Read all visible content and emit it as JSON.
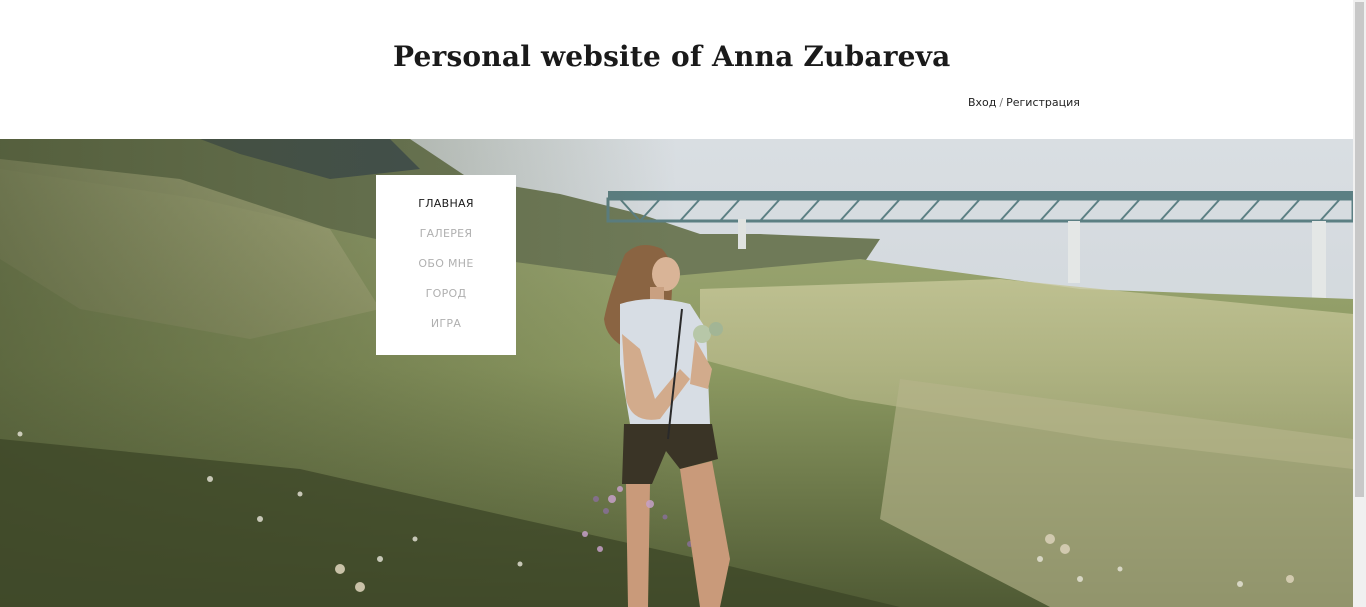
{
  "header": {
    "title": "Personal website of Anna Zubareva",
    "auth": {
      "login_label": "Вход",
      "separator": "/",
      "register_label": "Регистрация"
    }
  },
  "nav": {
    "items": [
      {
        "label": "ГЛАВНАЯ",
        "active": true
      },
      {
        "label": "ГАЛЕРЕЯ",
        "active": false
      },
      {
        "label": "ОБО МНЕ",
        "active": false
      },
      {
        "label": "ГОРОД",
        "active": false
      },
      {
        "label": "ИГРА",
        "active": false
      }
    ]
  },
  "colors": {
    "nav_active": "#1a1a1a",
    "nav_inactive": "#b0b0b0",
    "background": "#ffffff"
  }
}
